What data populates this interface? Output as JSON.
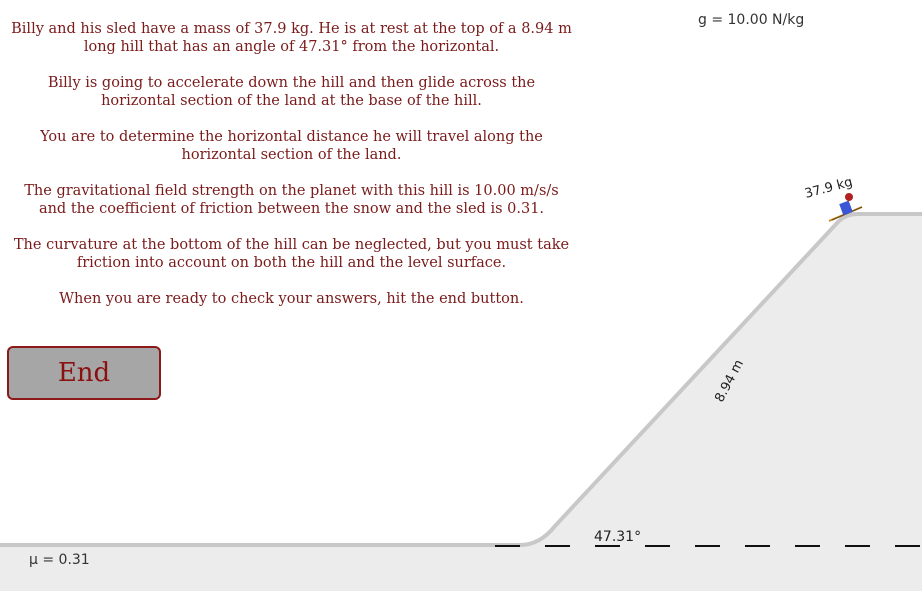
{
  "instructions": {
    "p1": "Billy and his sled have a mass of 37.9 kg. He is at rest at the top of a 8.94 m long hill that has an angle of 47.31° from the horizontal.",
    "p2": "Billy is going to accelerate down the hill and then glide across the horizontal section of the land at the base of the hill.",
    "p3": "You are to determine the horizontal distance he will travel along the horizontal section of the land.",
    "p4": "The gravitational field strength on the planet with this hill is 10.00 m/s/s and the coefficient of friction between the snow and the sled is 0.31.",
    "p5": "The curvature at the bottom of the hill can be neglected, but you must take friction into account on both the hill and the level surface.",
    "p6": "When you are ready to check your answers, hit the end button."
  },
  "end_button_label": "End",
  "readouts": {
    "gravity": "g = 10.00 N/kg",
    "friction": "μ = 0.31"
  },
  "diagram": {
    "mass_label": "37.9 kg",
    "hill_length_label": "8.94 m",
    "angle_label": "47.31°"
  },
  "colors": {
    "text": "#7a1a1a",
    "ground_fill": "#ececec",
    "ground_edge": "#c8c8c8",
    "button_bg": "#a6a6a6",
    "button_border": "#8b1a1a"
  }
}
